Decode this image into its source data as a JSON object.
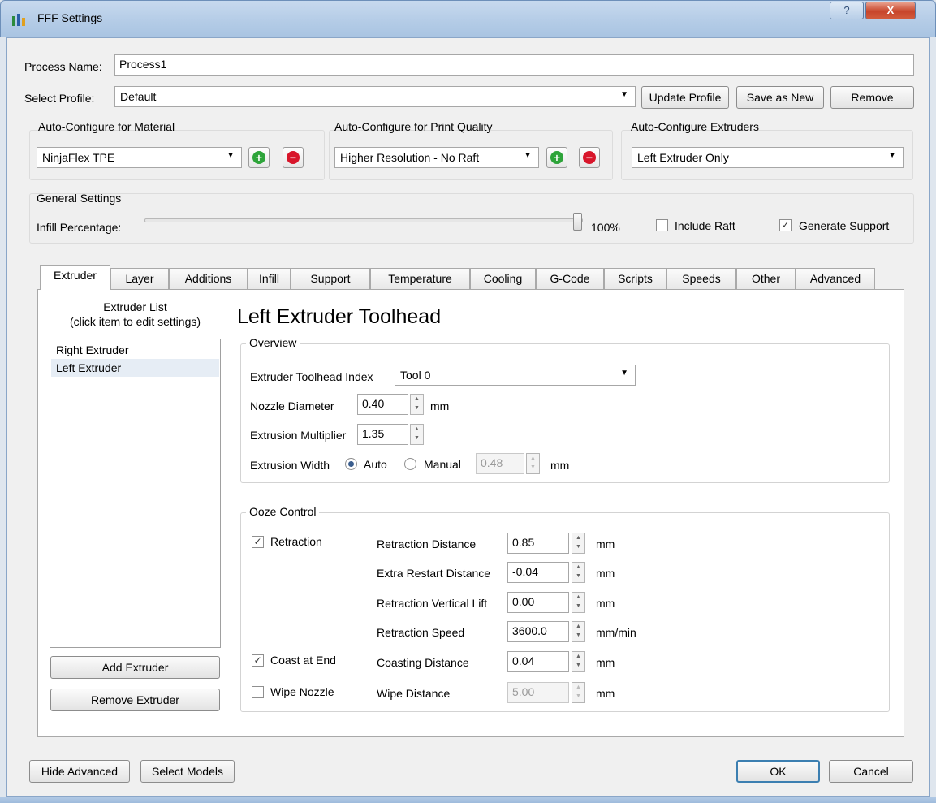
{
  "window": {
    "title": "FFF Settings",
    "help_glyph": "?",
    "close_glyph": "X"
  },
  "header": {
    "process_name_label": "Process Name:",
    "process_name_value": "Process1",
    "select_profile_label": "Select Profile:",
    "profile_value": "Default",
    "update_profile_label": "Update Profile",
    "save_as_new_label": "Save as New",
    "remove_label": "Remove"
  },
  "auto_configure": {
    "material": {
      "title": "Auto-Configure for Material",
      "value": "NinjaFlex TPE"
    },
    "print_quality": {
      "title": "Auto-Configure for Print Quality",
      "value": "Higher Resolution - No Raft"
    },
    "extruders": {
      "title": "Auto-Configure Extruders",
      "value": "Left Extruder Only"
    },
    "add_glyph": "+",
    "remove_glyph": "−"
  },
  "general": {
    "title": "General Settings",
    "infill_label": "Infill Percentage:",
    "infill_value_text": "100%",
    "infill_fraction": 1.0,
    "include_raft_label": "Include Raft",
    "include_raft_checked": false,
    "generate_support_label": "Generate Support",
    "generate_support_checked": true
  },
  "tabs": [
    "Extruder",
    "Layer",
    "Additions",
    "Infill",
    "Support",
    "Temperature",
    "Cooling",
    "G-Code",
    "Scripts",
    "Speeds",
    "Other",
    "Advanced"
  ],
  "active_tab": "Extruder",
  "extruder_list": {
    "header_line1": "Extruder List",
    "header_line2": "(click item to edit settings)",
    "items": [
      "Right Extruder",
      "Left Extruder"
    ],
    "selected": "Left Extruder",
    "add_label": "Add Extruder",
    "remove_label": "Remove Extruder"
  },
  "toolhead": {
    "title": "Left Extruder Toolhead",
    "overview": {
      "title": "Overview",
      "index_label": "Extruder Toolhead Index",
      "index_value": "Tool 0",
      "nozzle_label": "Nozzle Diameter",
      "nozzle_value": "0.40",
      "nozzle_unit": "mm",
      "multiplier_label": "Extrusion Multiplier",
      "multiplier_value": "1.35",
      "width_label": "Extrusion Width",
      "auto_label": "Auto",
      "manual_label": "Manual",
      "width_value": "0.48",
      "width_unit": "mm"
    },
    "ooze": {
      "title": "Ooze Control",
      "retraction_label": "Retraction",
      "retraction_checked": true,
      "coast_label": "Coast at End",
      "coast_checked": true,
      "wipe_label": "Wipe Nozzle",
      "wipe_checked": false,
      "fields": [
        {
          "label": "Retraction Distance",
          "value": "0.85",
          "unit": "mm"
        },
        {
          "label": "Extra Restart Distance",
          "value": "-0.04",
          "unit": "mm"
        },
        {
          "label": "Retraction Vertical Lift",
          "value": "0.00",
          "unit": "mm"
        },
        {
          "label": "Retraction Speed",
          "value": "3600.0",
          "unit": "mm/min"
        },
        {
          "label": "Coasting Distance",
          "value": "0.04",
          "unit": "mm"
        },
        {
          "label": "Wipe Distance",
          "value": "5.00",
          "unit": "mm"
        }
      ]
    }
  },
  "footer": {
    "hide_advanced_label": "Hide Advanced",
    "select_models_label": "Select Models",
    "ok_label": "OK",
    "cancel_label": "Cancel"
  },
  "colors": {
    "accent": "#3c7fb1",
    "add_icon": "#2ea43a",
    "remove_icon": "#d8162b"
  }
}
